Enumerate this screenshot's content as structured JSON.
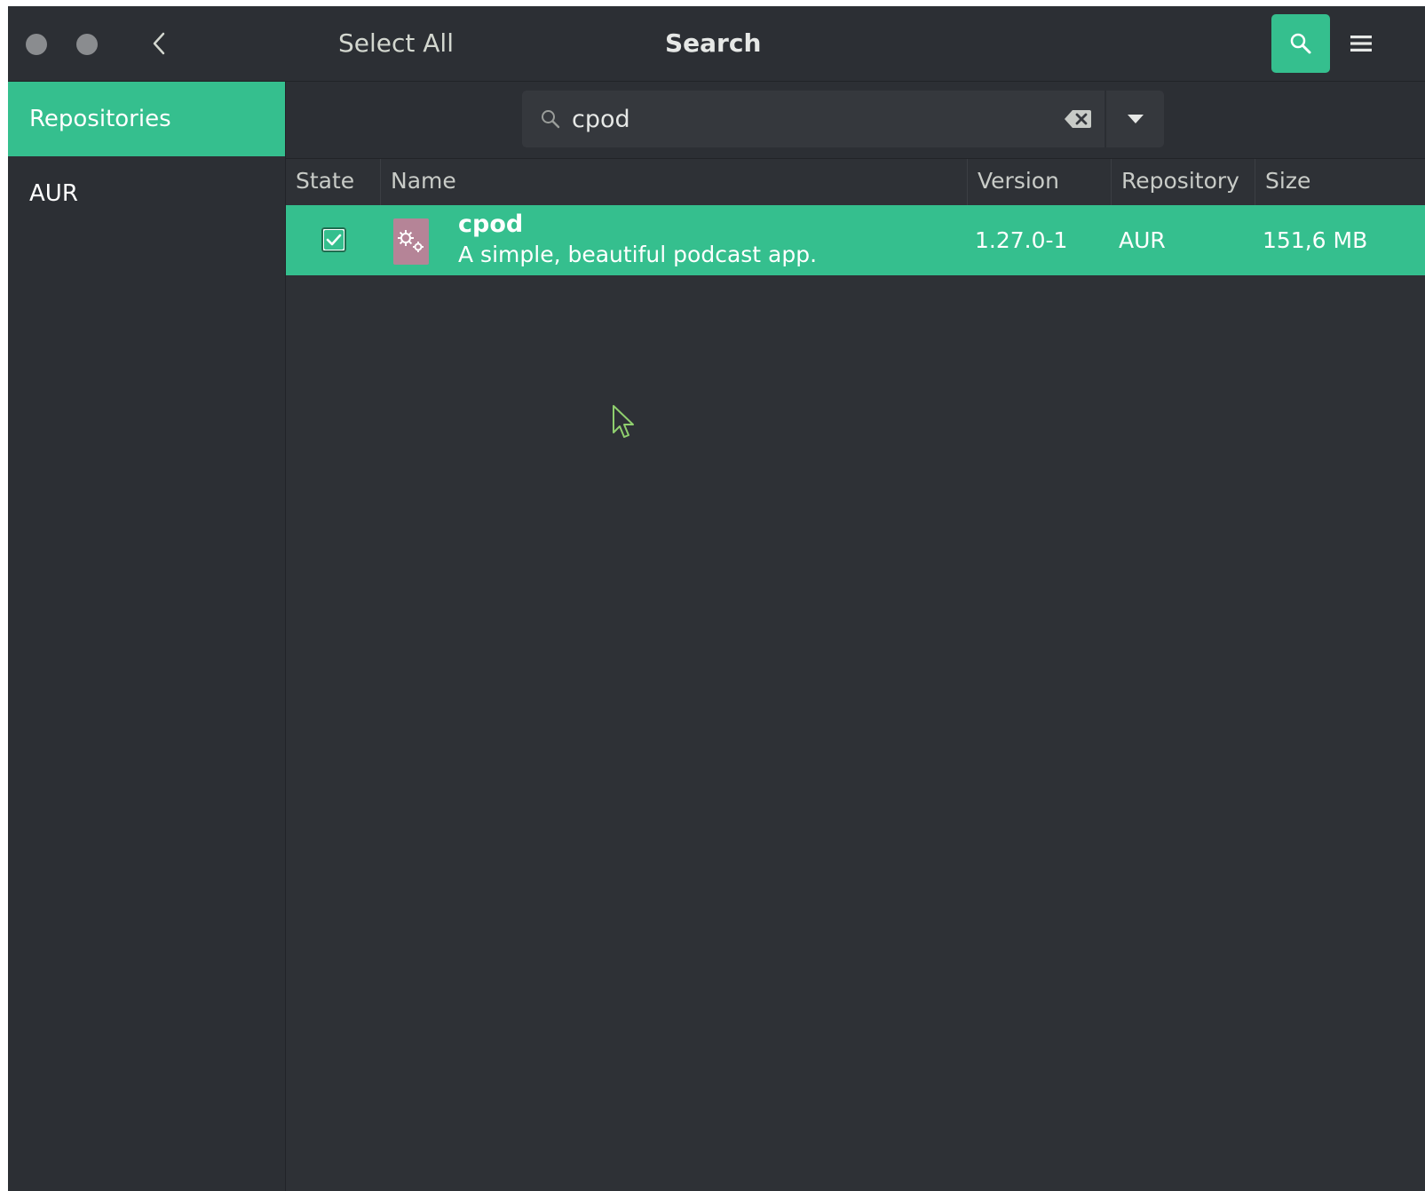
{
  "header": {
    "select_all_label": "Select All",
    "title": "Search"
  },
  "sidebar": {
    "items": [
      {
        "label": "Repositories",
        "active": true
      },
      {
        "label": "AUR",
        "active": false
      }
    ]
  },
  "search": {
    "value": "cpod",
    "placeholder": ""
  },
  "table": {
    "columns": [
      "State",
      "Name",
      "Version",
      "Repository",
      "Size"
    ],
    "rows": [
      {
        "state": "checked",
        "name": "cpod",
        "description": "A simple, beautiful podcast app.",
        "version": "1.27.0-1",
        "repository": "AUR",
        "size": "151,6 MB"
      }
    ]
  },
  "colors": {
    "accent": "#35bf8e",
    "background": "#2e3136",
    "headerbar": "#2c2f34",
    "package_icon": "#b58497"
  },
  "icons": {
    "back": "chevron-left-icon",
    "search": "search-icon",
    "menu": "hamburger-menu-icon",
    "clear": "backspace-clear-icon",
    "dropdown": "triangle-down-icon",
    "package": "gears-icon"
  }
}
